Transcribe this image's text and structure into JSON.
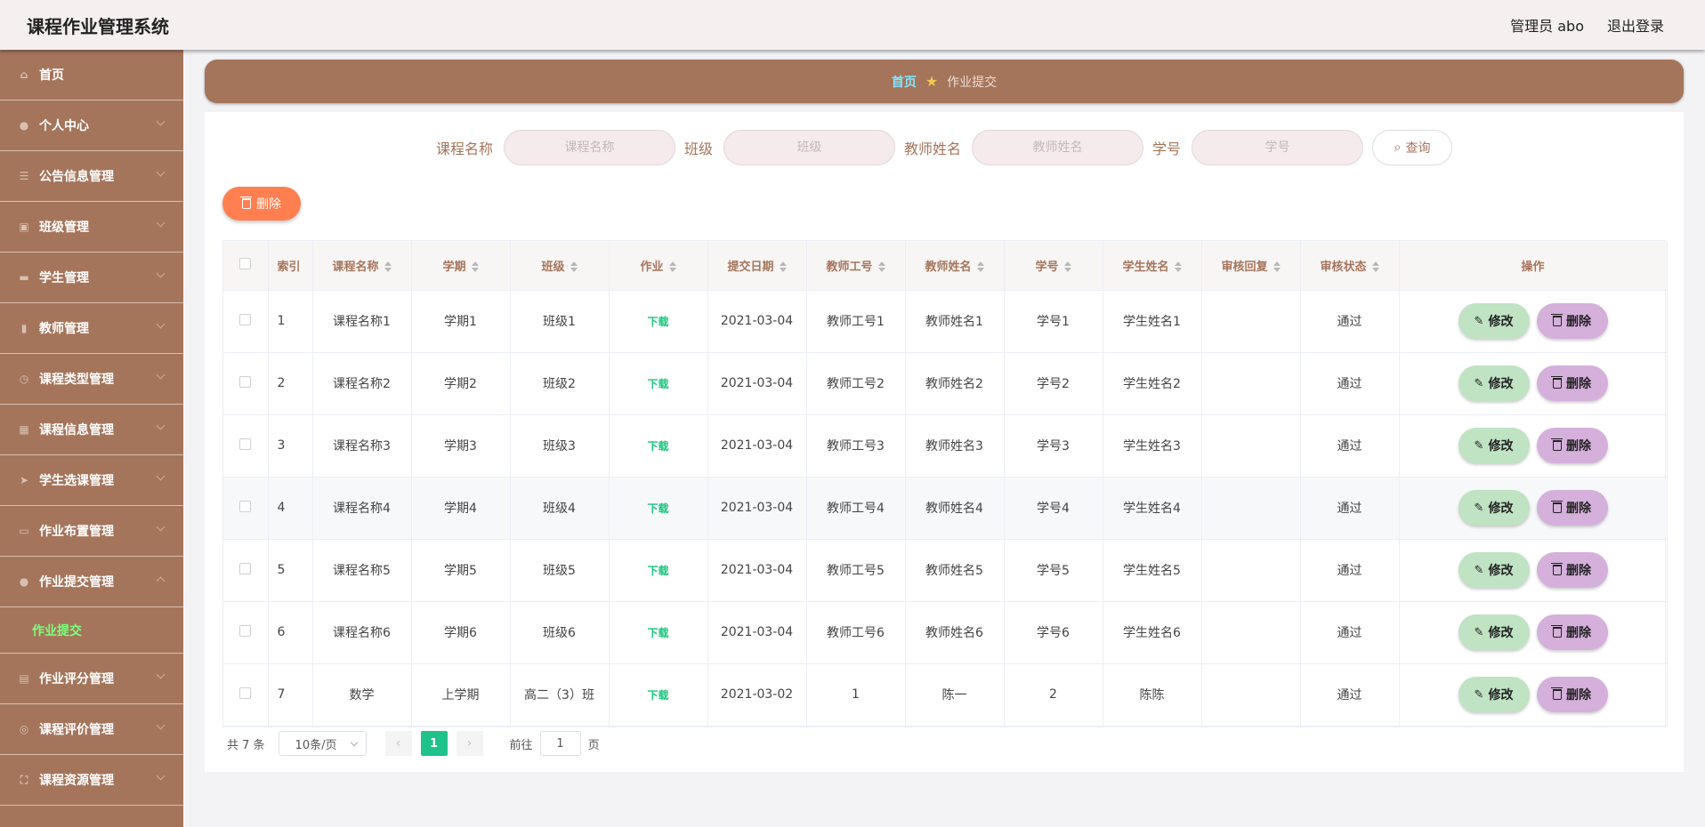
{
  "app": {
    "title": "课程作业管理系统"
  },
  "header": {
    "user_label": "管理员 abo",
    "logout_label": "退出登录"
  },
  "sidebar": {
    "items": [
      {
        "label": "首页",
        "icon": "home-icon",
        "glyph": "⌂",
        "expandable": false
      },
      {
        "label": "个人中心",
        "icon": "user-icon",
        "glyph": "●",
        "expandable": true
      },
      {
        "label": "公告信息管理",
        "icon": "list-icon",
        "glyph": "☰",
        "expandable": true
      },
      {
        "label": "班级管理",
        "icon": "clipboard-icon",
        "glyph": "▣",
        "expandable": true
      },
      {
        "label": "学生管理",
        "icon": "chat-icon",
        "glyph": "▬",
        "expandable": true
      },
      {
        "label": "教师管理",
        "icon": "chart-icon",
        "glyph": "▮",
        "expandable": true
      },
      {
        "label": "课程类型管理",
        "icon": "clock-icon",
        "glyph": "◷",
        "expandable": true
      },
      {
        "label": "课程信息管理",
        "icon": "grid-icon",
        "glyph": "▦",
        "expandable": true
      },
      {
        "label": "学生选课管理",
        "icon": "send-icon",
        "glyph": "➤",
        "expandable": true
      },
      {
        "label": "作业布置管理",
        "icon": "monitor-icon",
        "glyph": "▭",
        "expandable": true
      },
      {
        "label": "作业提交管理",
        "icon": "user-icon",
        "glyph": "●",
        "expandable": true,
        "expanded": true
      },
      {
        "label": "作业评分管理",
        "icon": "document-icon",
        "glyph": "▤",
        "expandable": true
      },
      {
        "label": "课程评价管理",
        "icon": "target-icon",
        "glyph": "◎",
        "expandable": true
      },
      {
        "label": "课程资源管理",
        "icon": "frame-icon",
        "glyph": "⛶",
        "expandable": true
      }
    ],
    "active_sub": "作业提交"
  },
  "breadcrumb": {
    "home": "首页",
    "current": "作业提交"
  },
  "search": {
    "fields": [
      {
        "label": "课程名称",
        "placeholder": "课程名称"
      },
      {
        "label": "班级",
        "placeholder": "班级"
      },
      {
        "label": "教师姓名",
        "placeholder": "教师姓名"
      },
      {
        "label": "学号",
        "placeholder": "学号"
      }
    ],
    "query_label": "查询"
  },
  "toolbar": {
    "delete_label": "删除"
  },
  "table": {
    "columns": [
      "索引",
      "课程名称",
      "学期",
      "班级",
      "作业",
      "提交日期",
      "教师工号",
      "教师姓名",
      "学号",
      "学生姓名",
      "审核回复",
      "审核状态",
      "操作"
    ],
    "rows": [
      {
        "index": "1",
        "course": "课程名称1",
        "term": "学期1",
        "class": "班级1",
        "homework": "下载",
        "date": "2021-03-04",
        "teacher_id": "教师工号1",
        "teacher_name": "教师姓名1",
        "student_id": "学号1",
        "student_name": "学生姓名1",
        "reply": "",
        "status": "通过"
      },
      {
        "index": "2",
        "course": "课程名称2",
        "term": "学期2",
        "class": "班级2",
        "homework": "下载",
        "date": "2021-03-04",
        "teacher_id": "教师工号2",
        "teacher_name": "教师姓名2",
        "student_id": "学号2",
        "student_name": "学生姓名2",
        "reply": "",
        "status": "通过"
      },
      {
        "index": "3",
        "course": "课程名称3",
        "term": "学期3",
        "class": "班级3",
        "homework": "下载",
        "date": "2021-03-04",
        "teacher_id": "教师工号3",
        "teacher_name": "教师姓名3",
        "student_id": "学号3",
        "student_name": "学生姓名3",
        "reply": "",
        "status": "通过"
      },
      {
        "index": "4",
        "course": "课程名称4",
        "term": "学期4",
        "class": "班级4",
        "homework": "下载",
        "date": "2021-03-04",
        "teacher_id": "教师工号4",
        "teacher_name": "教师姓名4",
        "student_id": "学号4",
        "student_name": "学生姓名4",
        "reply": "",
        "status": "通过"
      },
      {
        "index": "5",
        "course": "课程名称5",
        "term": "学期5",
        "class": "班级5",
        "homework": "下载",
        "date": "2021-03-04",
        "teacher_id": "教师工号5",
        "teacher_name": "教师姓名5",
        "student_id": "学号5",
        "student_name": "学生姓名5",
        "reply": "",
        "status": "通过"
      },
      {
        "index": "6",
        "course": "课程名称6",
        "term": "学期6",
        "class": "班级6",
        "homework": "下载",
        "date": "2021-03-04",
        "teacher_id": "教师工号6",
        "teacher_name": "教师姓名6",
        "student_id": "学号6",
        "student_name": "学生姓名6",
        "reply": "",
        "status": "通过"
      },
      {
        "index": "7",
        "course": "数学",
        "term": "上学期",
        "class": "高二（3）班",
        "homework": "下载",
        "date": "2021-03-02",
        "teacher_id": "1",
        "teacher_name": "陈一",
        "student_id": "2",
        "student_name": "陈陈",
        "reply": "",
        "status": "通过"
      }
    ],
    "edit_label": "修改",
    "delete_label": "删除"
  },
  "pagination": {
    "total_text": "共 7 条",
    "page_size": "10条/页",
    "current_page": "1",
    "goto_prefix": "前往",
    "goto_value": "1",
    "goto_suffix": "页"
  },
  "colors": {
    "brand": "#a5755b",
    "accent_green": "#1fc28a",
    "delete_orange": "#ff7f50",
    "edit_green": "#bfe3c3",
    "delete_purple": "#d4b0db"
  }
}
